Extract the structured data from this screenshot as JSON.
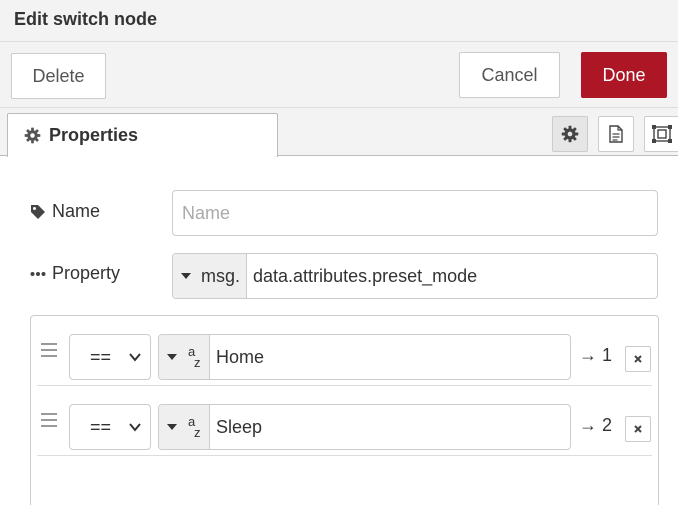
{
  "dialog": {
    "title": "Edit switch node"
  },
  "toolbar": {
    "delete_label": "Delete",
    "cancel_label": "Cancel",
    "done_label": "Done"
  },
  "tabs": {
    "active_label": "Properties",
    "active_icon": "gear-icon",
    "side_icons": [
      "gear-icon",
      "document-icon",
      "frame-icon"
    ]
  },
  "form": {
    "name": {
      "label": "Name",
      "icon": "tag-icon",
      "placeholder": "Name",
      "value": ""
    },
    "property": {
      "label": "Property",
      "icon": "dots-icon",
      "type": "msg.",
      "value": "data.attributes.preset_mode"
    }
  },
  "rules": [
    {
      "operator": "==",
      "type_icon": "string-az-icon",
      "a": "a",
      "z": "z",
      "value": "Home",
      "output": "→ 1"
    },
    {
      "operator": "==",
      "type_icon": "string-az-icon",
      "a": "a",
      "z": "z",
      "value": "Sleep",
      "output": "→ 2"
    }
  ],
  "colors": {
    "done": "#ad1625",
    "chrome": "#f3f3f3",
    "border": "#cccccc"
  }
}
